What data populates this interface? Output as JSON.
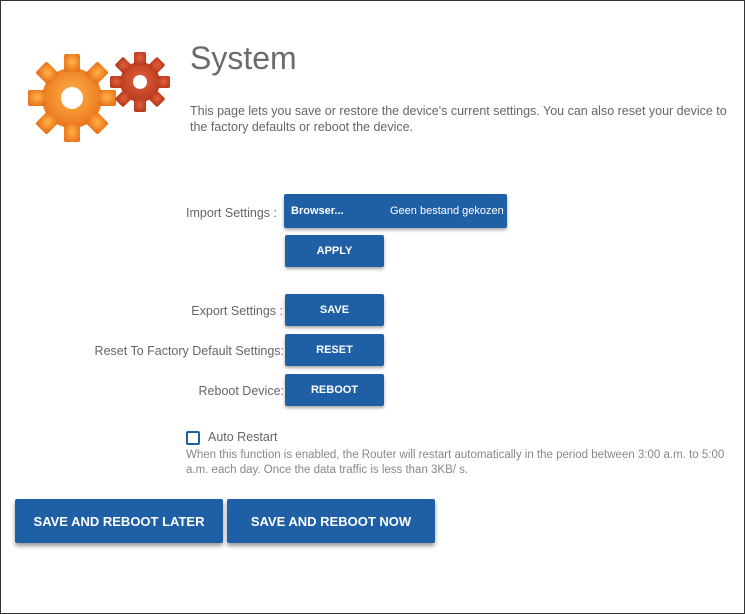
{
  "header": {
    "title": "System",
    "description": "This page lets you save or restore the device's current settings. You can also reset your device to the factory defaults or reboot the device."
  },
  "import": {
    "label": "Import Settings :",
    "browse_label": "Browser...",
    "file_status": "Geen bestand gekozen",
    "apply_label": "APPLY"
  },
  "export": {
    "label": "Export Settings :",
    "button_label": "SAVE"
  },
  "reset": {
    "label": "Reset To Factory Default Settings:",
    "button_label": "RESET"
  },
  "reboot": {
    "label": "Reboot Device:",
    "button_label": "REBOOT"
  },
  "auto_restart": {
    "label": "Auto Restart",
    "checked": false,
    "note": "When this function is enabled, the Router will restart automatically in the period between 3:00 a.m. to 5:00 a.m. each day. Once the data traffic is less than 3KB/ s."
  },
  "actions": {
    "save_later_label": "SAVE AND REBOOT LATER",
    "save_now_label": "SAVE AND REBOOT NOW"
  },
  "colors": {
    "button_blue": "#1f5fa6",
    "gear_orange": "#f5891f",
    "gear_red": "#c84224"
  },
  "icons": {
    "logo": "gears-icon"
  }
}
